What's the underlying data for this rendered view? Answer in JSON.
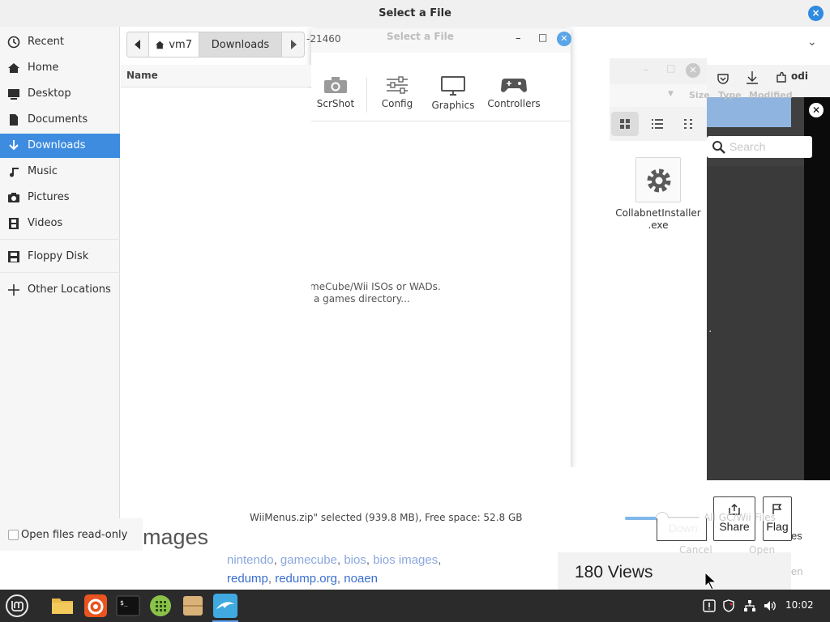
{
  "dialog": {
    "title": "Select a File",
    "close_label": "×",
    "chevron": "⌄"
  },
  "sidebar": {
    "items": [
      {
        "label": "Recent",
        "icon": "clock-icon"
      },
      {
        "label": "Home",
        "icon": "home-icon"
      },
      {
        "label": "Desktop",
        "icon": "desktop-icon"
      },
      {
        "label": "Documents",
        "icon": "document-icon"
      },
      {
        "label": "Downloads",
        "icon": "download-icon",
        "active": true
      },
      {
        "label": "Music",
        "icon": "music-icon"
      },
      {
        "label": "Pictures",
        "icon": "camera-icon"
      },
      {
        "label": "Videos",
        "icon": "film-icon"
      },
      {
        "label": "Floppy Disk",
        "icon": "floppy-icon"
      },
      {
        "label": "Other Locations",
        "icon": "plus-icon"
      }
    ]
  },
  "pathbar": {
    "home_label": "vm7",
    "current_label": "Downloads"
  },
  "list": {
    "name_header": "Name"
  },
  "statusbar": {
    "text": "WiiMenus.zip\" selected (939.8 MB), Free space: 52.8 GB",
    "filter_ghost": "All GC/Wii Files",
    "cancel_ghost": "Cancel",
    "open_ghost": "Open",
    "zoom_fraction": 0.5
  },
  "options": {
    "read_only_label": "Open files read-only"
  },
  "dolphin": {
    "title": "Select a File",
    "id_fragment": "-21460",
    "tools": [
      "ScrShot",
      "Config",
      "Graphics",
      "Controllers"
    ],
    "message_line1": "meCube/Wii ISOs or WADs.",
    "message_line2": "a games directory..."
  },
  "file_manager": {
    "col_size": "Size",
    "col_type": "Type",
    "col_modified": "Modified",
    "file_name_1": "CollabnetInstaller",
    "file_name_2": ".exe"
  },
  "browser": {
    "search_placeholder": "Search",
    "images_heading": "mages",
    "tags_line1": [
      "nintendo",
      "gamecube",
      "bios",
      "bios images"
    ],
    "tags_line2": [
      "redump",
      "redump.org",
      "noaen"
    ],
    "views": "180 Views",
    "share_label": "Share",
    "flag_label": "Flag",
    "odi_fragment": "odi",
    "ghost_es": "es",
    "ghost_en": "en",
    "ghost_down": "Down",
    "dot": "."
  },
  "taskbar": {
    "clock": "10:02"
  }
}
